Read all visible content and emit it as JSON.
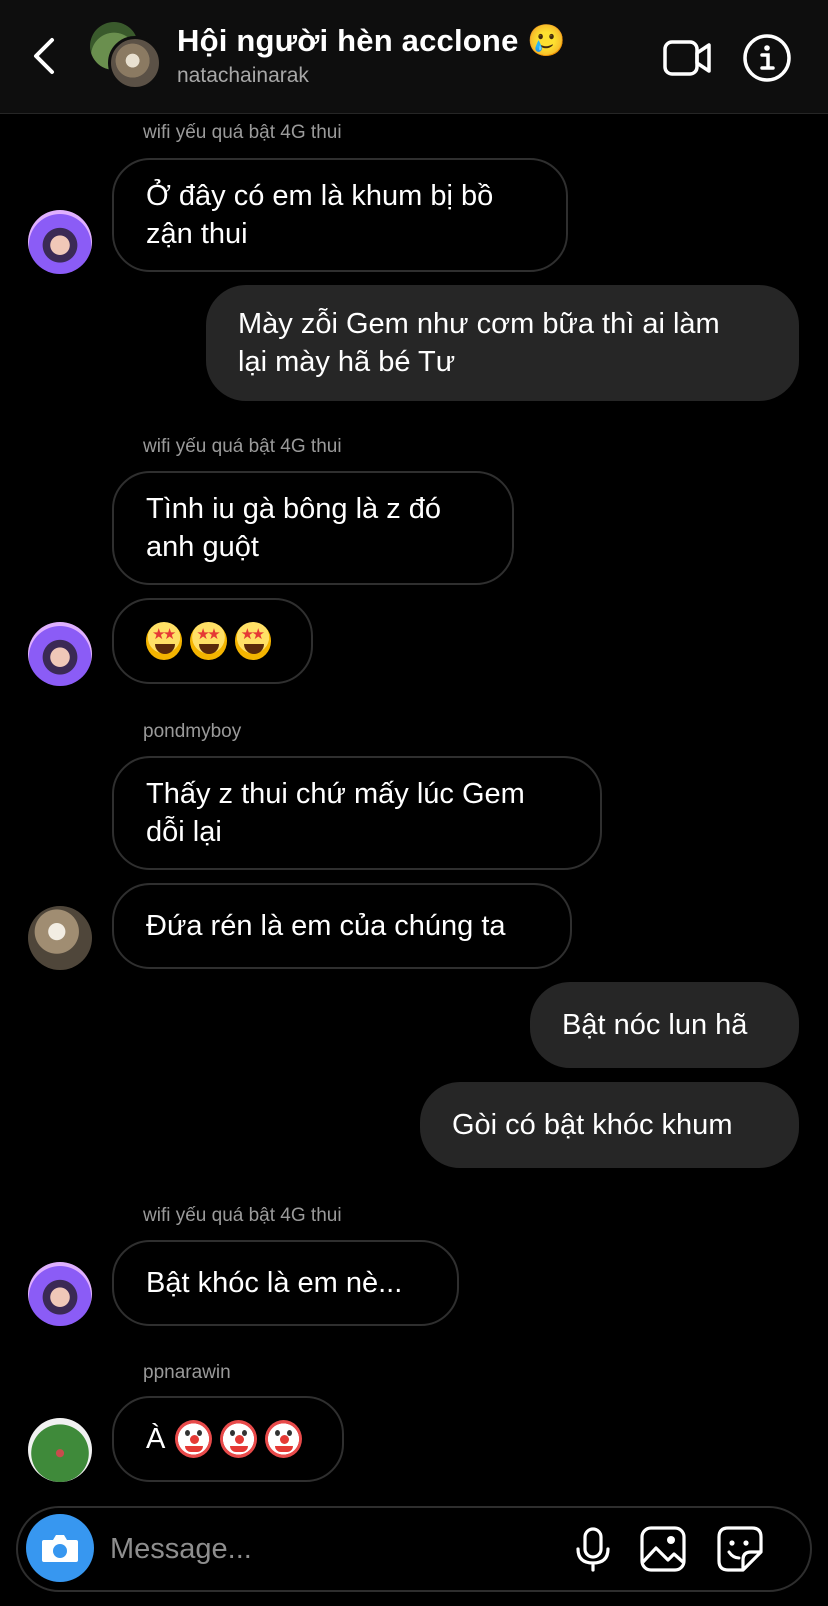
{
  "header": {
    "title": "Hội người hèn acclone 🥲",
    "subtitle": "natachainarak"
  },
  "messages": [
    {
      "sender": "wifi yếu quá bật 4G thui",
      "text": "Ở đây có em là khum bị bồ\nzận thui"
    },
    {
      "text": "Mày zỗi Gem như cơm bữa thì ai làm\nlại mày hã bé Tư"
    },
    {
      "sender": "wifi yếu quá bật 4G thui",
      "text": "Tình iu gà bông là z đó\nanh guột"
    },
    {
      "emoji_count": 3,
      "emoji": "star-struck"
    },
    {
      "sender": "pondmyboy",
      "text": "Thấy z thui chứ mấy lúc Gem\ndỗi lại"
    },
    {
      "text": "Đứa rén là em của chúng ta"
    },
    {
      "text": "Bật nóc lun hã"
    },
    {
      "text": "Gòi có bật khóc khum"
    },
    {
      "sender": "wifi yếu quá bật 4G thui",
      "text": "Bật khóc là em nè..."
    },
    {
      "sender": "ppnarawin",
      "text": "À",
      "emoji": "clown"
    }
  ],
  "composer": {
    "placeholder": "Message..."
  },
  "icons": {
    "back": "chevron-left-icon",
    "video": "video-call-icon",
    "info": "info-icon",
    "camera": "camera-icon",
    "mic": "microphone-icon",
    "gallery": "gallery-icon",
    "sticker": "sticker-icon"
  },
  "colors": {
    "background": "#000000",
    "outgoing_bubble": "#262626",
    "accent": "#3797f0"
  }
}
